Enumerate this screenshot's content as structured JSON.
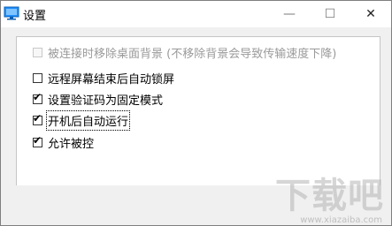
{
  "window": {
    "title": "设置",
    "minimize_glyph": "—",
    "maximize_glyph": "☐",
    "close_glyph": "✕"
  },
  "options": [
    {
      "label": "被连接时移除桌面背景 (不移除背景会导致传输速度下降)",
      "checked": false,
      "disabled": true
    },
    {
      "label": "远程屏幕结束后自动锁屏",
      "checked": false,
      "disabled": false
    },
    {
      "label": "设置验证码为固定模式",
      "checked": true,
      "disabled": false
    },
    {
      "label": "开机后自动运行",
      "checked": true,
      "disabled": false,
      "focused": true
    },
    {
      "label": "允许被控",
      "checked": true,
      "disabled": false
    }
  ],
  "watermark": {
    "text": "下载吧",
    "sub": "www.xiazaiba.com"
  },
  "colors": {
    "accent": "#1e90ff",
    "window_bg": "#f0f0f0",
    "frame_border": "#c6c6c6"
  }
}
